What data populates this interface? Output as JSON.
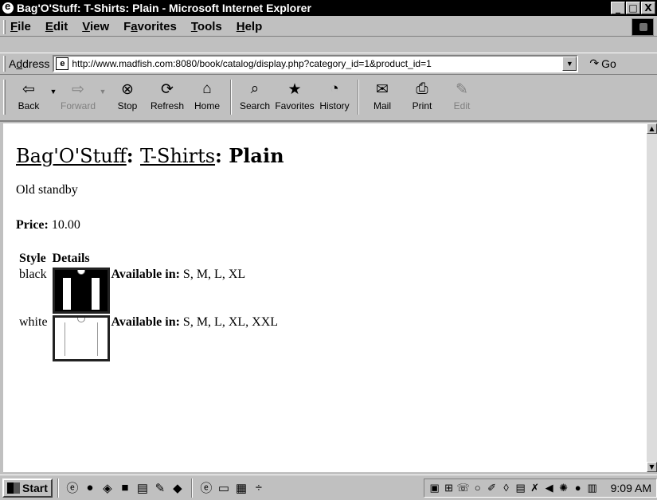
{
  "window": {
    "title": "Bag'O'Stuff: T-Shirts: Plain - Microsoft Internet Explorer",
    "controls": [
      "_",
      "□",
      "X"
    ]
  },
  "menubar": {
    "items": [
      {
        "underline": "F",
        "rest": "ile"
      },
      {
        "underline": "E",
        "rest": "dit"
      },
      {
        "underline": "V",
        "rest": "iew"
      },
      {
        "pre": "F",
        "underline": "a",
        "rest": "vorites"
      },
      {
        "underline": "T",
        "rest": "ools"
      },
      {
        "underline": "H",
        "rest": "elp"
      }
    ]
  },
  "address": {
    "label_pre": "A",
    "label_ul": "d",
    "label_rest": "dress",
    "url": "http://www.madfish.com:8080/book/catalog/display.php?category_id=1&product_id=1",
    "go_label": "Go"
  },
  "toolbar": {
    "back": "Back",
    "forward": "Forward",
    "stop": "Stop",
    "refresh": "Refresh",
    "home": "Home",
    "search": "Search",
    "favorites": "Favorites",
    "history": "History",
    "mail": "Mail",
    "print": "Print",
    "edit": "Edit"
  },
  "page": {
    "breadcrumb_store": "Bag'O'Stuff",
    "breadcrumb_category": "T-Shirts",
    "product_name": "Plain",
    "sep": ": ",
    "description": "Old standby",
    "price_label": "Price:",
    "price_value": "10.00",
    "table": {
      "headers": [
        "Style",
        "Details"
      ],
      "rows": [
        {
          "style": "black",
          "avail_label": "Available in:",
          "sizes": "S, M, L, XL"
        },
        {
          "style": "white",
          "avail_label": "Available in:",
          "sizes": "S, M, L, XL, XXL"
        }
      ]
    }
  },
  "taskbar": {
    "start": "Start",
    "clock": "9:09 AM"
  }
}
